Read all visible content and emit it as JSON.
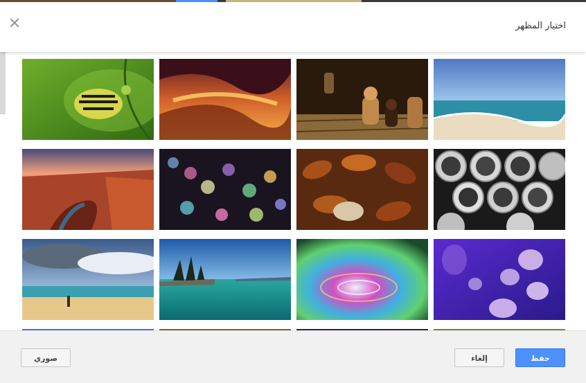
{
  "dialog": {
    "title": "اختيار المظهر"
  },
  "footer": {
    "save_label": "حفظ",
    "cancel_label": "إلغاء",
    "my_photos_label": "صوري"
  },
  "themes": [
    "caterpillar",
    "canyon-rock",
    "chess",
    "beach-sea",
    "grand-canyon",
    "bokeh-lights",
    "autumn-leaves",
    "metal-pipes",
    "beach-clouds",
    "lake-trees",
    "water-drop",
    "jellyfish"
  ],
  "colors": {
    "primary_button": "#4d90fe",
    "footer_bg": "#f1f1f1"
  }
}
